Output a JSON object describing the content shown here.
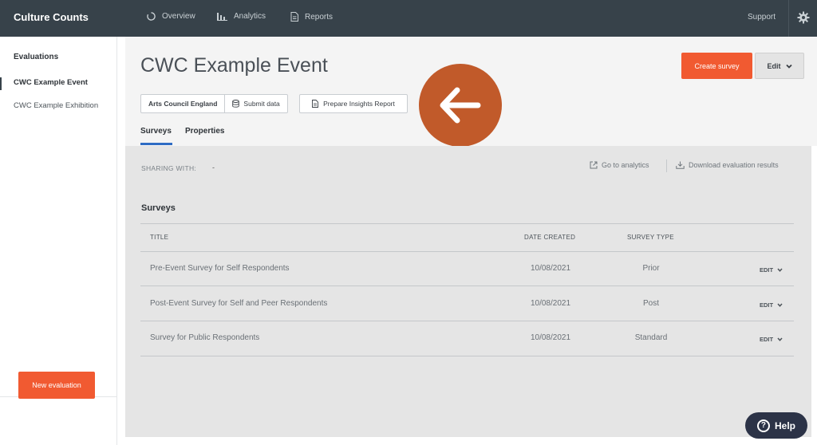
{
  "brand": "Culture Counts",
  "nav": {
    "items": [
      {
        "label": "Overview",
        "icon": "overview-icon"
      },
      {
        "label": "Analytics",
        "icon": "analytics-icon"
      },
      {
        "label": "Reports",
        "icon": "reports-icon"
      }
    ],
    "support": "Support",
    "settings_icon": "gear-icon"
  },
  "sidebar": {
    "heading": "Evaluations",
    "items": [
      {
        "label": "CWC Example Event",
        "active": true
      },
      {
        "label": "CWC Example Exhibition",
        "active": false
      }
    ],
    "new_button": "New evaluation"
  },
  "header": {
    "title": "CWC Example Event",
    "create_button": "Create survey",
    "edit_button": "Edit",
    "funder_label": "Arts Council England",
    "submit_label": "Submit data",
    "insights_label": "Prepare Insights Report",
    "tabs": [
      {
        "label": "Surveys",
        "active": true
      },
      {
        "label": "Properties",
        "active": false
      }
    ]
  },
  "main": {
    "sharing_label": "SHARING WITH:",
    "sharing_value": "-",
    "analytics_link": "Go to analytics",
    "download_link": "Download evaluation results",
    "section_title": "Surveys",
    "columns": [
      "TITLE",
      "DATE CREATED",
      "SURVEY TYPE"
    ],
    "rows": [
      {
        "title": "Pre-Event Survey for Self Respondents",
        "date": "10/08/2021",
        "type": "Prior",
        "action": "EDIT"
      },
      {
        "title": "Post-Event Survey for Self and Peer Respondents",
        "date": "10/08/2021",
        "type": "Post",
        "action": "EDIT"
      },
      {
        "title": "Survey for Public Respondents",
        "date": "10/08/2021",
        "type": "Standard",
        "action": "EDIT"
      }
    ]
  },
  "help_button": "Help",
  "colors": {
    "topbar": "#37424a",
    "accent": "#f15a31",
    "tab_underline": "#2f6cc4",
    "arrow_overlay": "#c15a2a",
    "help_bg": "#2c3347"
  }
}
